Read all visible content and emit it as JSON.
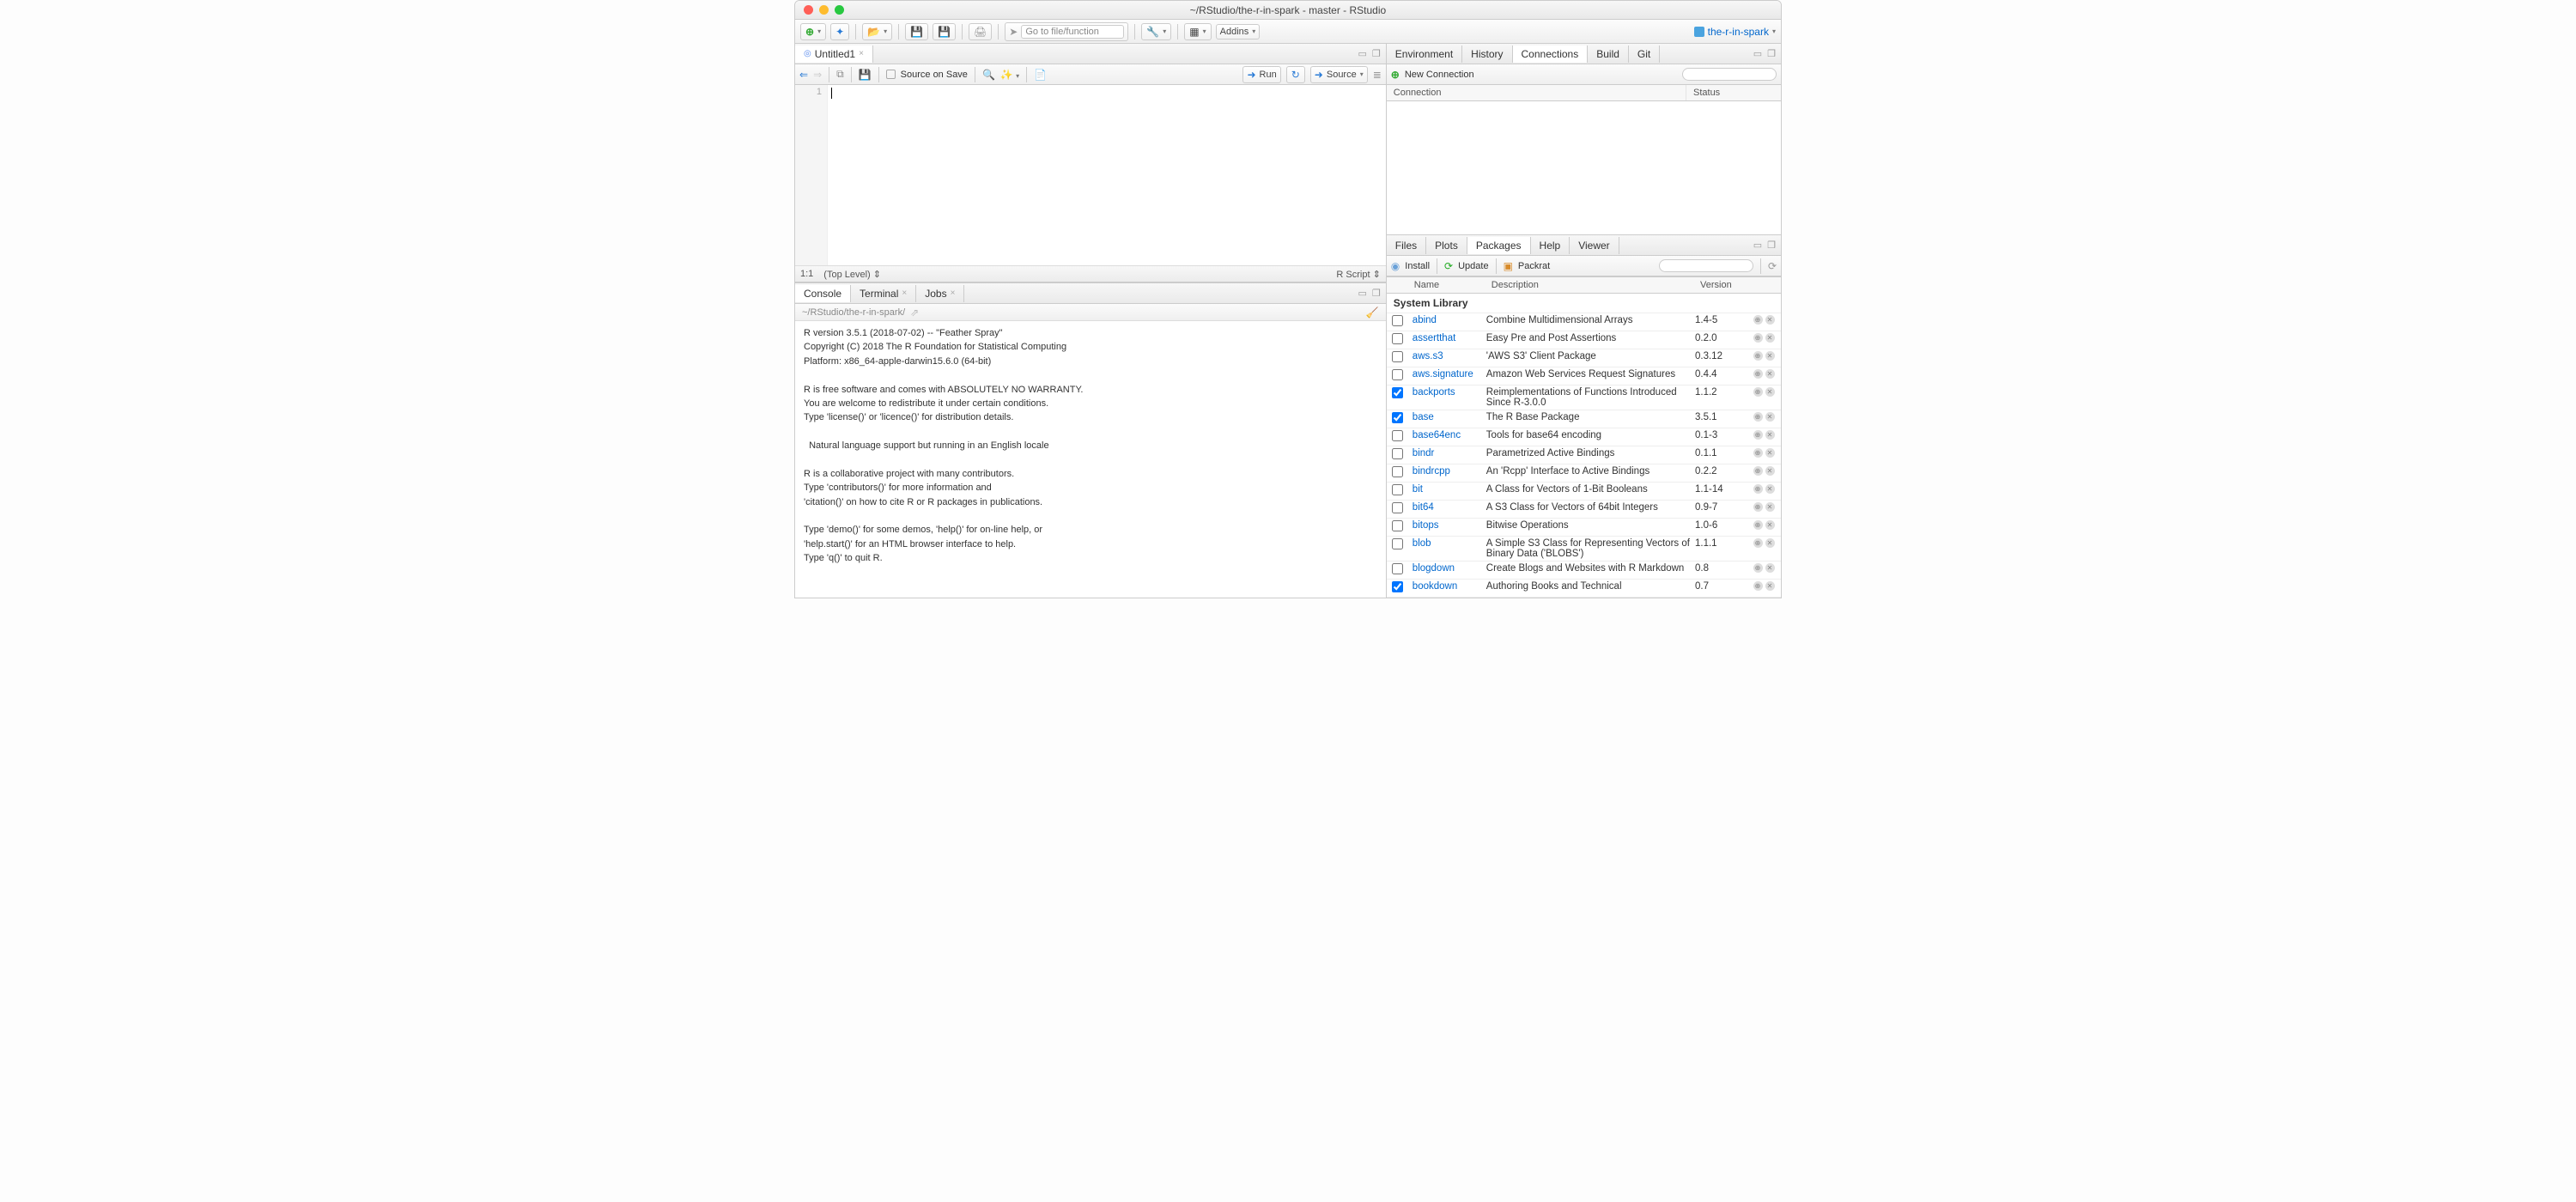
{
  "window": {
    "title": "~/RStudio/the-r-in-spark - master - RStudio"
  },
  "toolbar": {
    "gotoPlaceholder": "Go to file/function",
    "addins": "Addins",
    "project": "the-r-in-spark"
  },
  "sourcePane": {
    "tab": "Untitled1",
    "sourceOnSave": "Source on Save",
    "run": "Run",
    "source": "Source",
    "line1": "1",
    "status_pos": "1:1",
    "status_scope": "(Top Level)",
    "status_type": "R Script"
  },
  "consolePane": {
    "tabs": [
      "Console",
      "Terminal",
      "Jobs"
    ],
    "path": "~/RStudio/the-r-in-spark/",
    "text": "R version 3.5.1 (2018-07-02) -- \"Feather Spray\"\nCopyright (C) 2018 The R Foundation for Statistical Computing\nPlatform: x86_64-apple-darwin15.6.0 (64-bit)\n\nR is free software and comes with ABSOLUTELY NO WARRANTY.\nYou are welcome to redistribute it under certain conditions.\nType 'license()' or 'licence()' for distribution details.\n\n  Natural language support but running in an English locale\n\nR is a collaborative project with many contributors.\nType 'contributors()' for more information and\n'citation()' on how to cite R or R packages in publications.\n\nType 'demo()' for some demos, 'help()' for on-line help, or\n'help.start()' for an HTML browser interface to help.\nType 'q()' to quit R.\n",
    "prompt": ">"
  },
  "envPane": {
    "tabs": [
      "Environment",
      "History",
      "Connections",
      "Build",
      "Git"
    ],
    "newConn": "New Connection",
    "hdrConn": "Connection",
    "hdrStatus": "Status"
  },
  "pkgPane": {
    "tabs": [
      "Files",
      "Plots",
      "Packages",
      "Help",
      "Viewer"
    ],
    "install": "Install",
    "update": "Update",
    "packrat": "Packrat",
    "cols": {
      "name": "Name",
      "desc": "Description",
      "ver": "Version"
    },
    "syslib": "System Library",
    "rows": [
      {
        "ck": false,
        "name": "abind",
        "desc": "Combine Multidimensional Arrays",
        "ver": "1.4-5"
      },
      {
        "ck": false,
        "name": "assertthat",
        "desc": "Easy Pre and Post Assertions",
        "ver": "0.2.0"
      },
      {
        "ck": false,
        "name": "aws.s3",
        "desc": "'AWS S3' Client Package",
        "ver": "0.3.12"
      },
      {
        "ck": false,
        "name": "aws.signature",
        "desc": "Amazon Web Services Request Signatures",
        "ver": "0.4.4"
      },
      {
        "ck": true,
        "name": "backports",
        "desc": "Reimplementations of Functions Introduced Since R-3.0.0",
        "ver": "1.1.2"
      },
      {
        "ck": true,
        "name": "base",
        "desc": "The R Base Package",
        "ver": "3.5.1"
      },
      {
        "ck": false,
        "name": "base64enc",
        "desc": "Tools for base64 encoding",
        "ver": "0.1-3"
      },
      {
        "ck": false,
        "name": "bindr",
        "desc": "Parametrized Active Bindings",
        "ver": "0.1.1"
      },
      {
        "ck": false,
        "name": "bindrcpp",
        "desc": "An 'Rcpp' Interface to Active Bindings",
        "ver": "0.2.2"
      },
      {
        "ck": false,
        "name": "bit",
        "desc": "A Class for Vectors of 1-Bit Booleans",
        "ver": "1.1-14"
      },
      {
        "ck": false,
        "name": "bit64",
        "desc": "A S3 Class for Vectors of 64bit Integers",
        "ver": "0.9-7"
      },
      {
        "ck": false,
        "name": "bitops",
        "desc": "Bitwise Operations",
        "ver": "1.0-6"
      },
      {
        "ck": false,
        "name": "blob",
        "desc": "A Simple S3 Class for Representing Vectors of Binary Data ('BLOBS')",
        "ver": "1.1.1"
      },
      {
        "ck": false,
        "name": "blogdown",
        "desc": "Create Blogs and Websites with R Markdown",
        "ver": "0.8"
      },
      {
        "ck": true,
        "name": "bookdown",
        "desc": "Authoring Books and Technical",
        "ver": "0.7"
      }
    ]
  }
}
